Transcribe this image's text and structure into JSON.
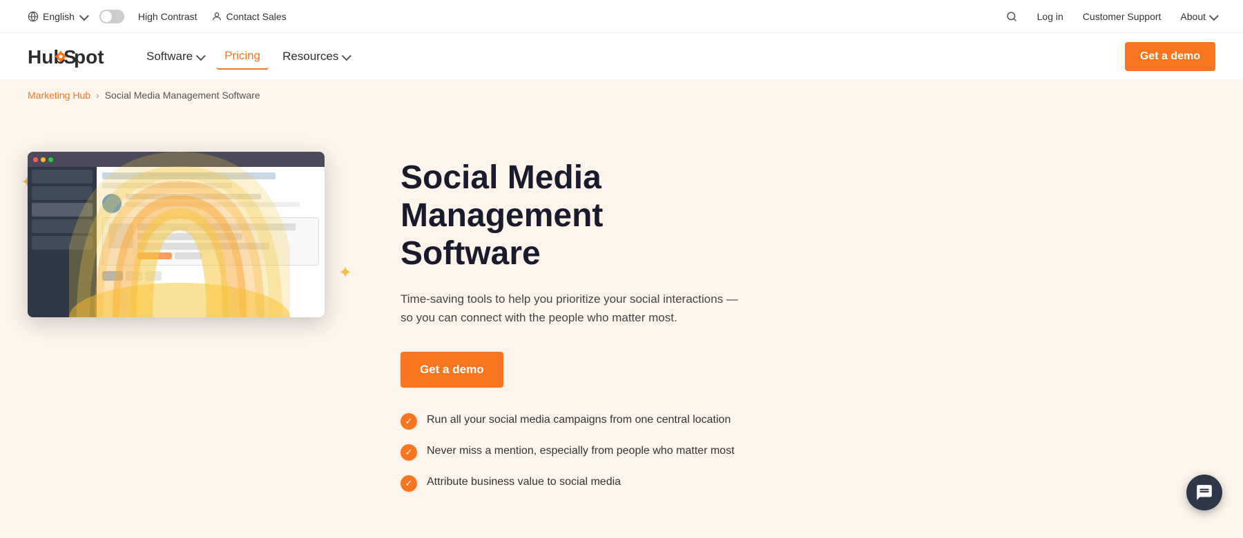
{
  "topbar": {
    "language": "English",
    "high_contrast": "High Contrast",
    "contact_sales": "Contact Sales",
    "login": "Log in",
    "customer_support": "Customer Support",
    "about": "About"
  },
  "nav": {
    "logo": "HubSpot",
    "software": "Software",
    "pricing": "Pricing",
    "resources": "Resources",
    "cta": "Get a demo"
  },
  "breadcrumb": {
    "parent": "Marketing Hub",
    "separator": "›",
    "current": "Social Media Management Software"
  },
  "hero": {
    "title": "Social Media Management Software",
    "subtitle": "Time-saving tools to help you prioritize your social interactions — so you can connect with the people who matter most.",
    "cta": "Get a demo",
    "features": [
      "Run all your social media campaigns from one central location",
      "Never miss a mention, especially from people who matter most",
      "Attribute business value to social media"
    ]
  }
}
